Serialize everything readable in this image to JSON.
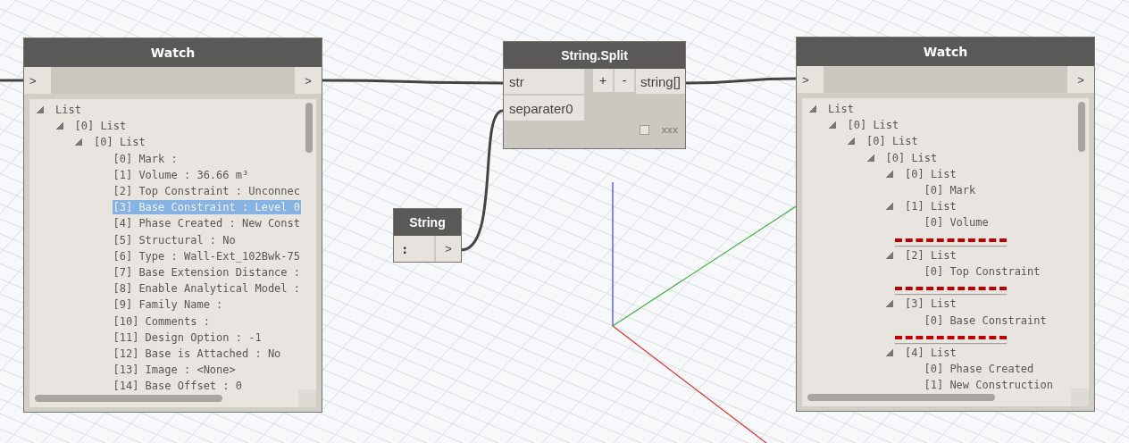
{
  "canvas": {
    "nodes": [
      {
        "kind": "watch",
        "title": "Watch",
        "input_port": ">",
        "output_port": ">",
        "tree": {
          "label": "List",
          "expanded": true,
          "children": [
            {
              "label": "[0] List",
              "expanded": true,
              "children": [
                {
                  "label": "[0] List",
                  "expanded": true,
                  "children": [
                    {
                      "label": "[0] Mark :",
                      "selected": false
                    },
                    {
                      "label": "[1] Volume : 36.66 m³",
                      "selected": false
                    },
                    {
                      "label": "[2] Top Constraint : Unconnec",
                      "selected": false
                    },
                    {
                      "label": "[3] Base Constraint : Level 0",
                      "selected": true
                    },
                    {
                      "label": "[4] Phase Created : New Const",
                      "selected": false
                    },
                    {
                      "label": "[5] Structural : No",
                      "selected": false
                    },
                    {
                      "label": "[6] Type : Wall-Ext_102Bwk-75",
                      "selected": false
                    },
                    {
                      "label": "[7] Base Extension Distance :",
                      "selected": false
                    },
                    {
                      "label": "[8] Enable Analytical Model :",
                      "selected": false
                    },
                    {
                      "label": "[9] Family Name :",
                      "selected": false
                    },
                    {
                      "label": "[10] Comments :",
                      "selected": false
                    },
                    {
                      "label": "[11] Design Option : -1",
                      "selected": false
                    },
                    {
                      "label": "[12] Base is Attached : No",
                      "selected": false
                    },
                    {
                      "label": "[13] Image : <None>",
                      "selected": false
                    },
                    {
                      "label": "[14] Base Offset : 0",
                      "selected": false
                    }
                  ]
                }
              ]
            }
          ]
        }
      },
      {
        "kind": "function",
        "title": "String.Split",
        "inputs": [
          "str",
          "separater0"
        ],
        "buttons": [
          "+",
          "-"
        ],
        "outputs": [
          "string[]"
        ],
        "preview_checked": false,
        "lacing": "xxx"
      },
      {
        "kind": "string",
        "title": "String",
        "value": ":",
        "output_port": ">"
      },
      {
        "kind": "watch",
        "title": "Watch",
        "input_port": ">",
        "output_port": ">",
        "tree": {
          "label": "List",
          "expanded": true,
          "children": [
            {
              "label": "[0] List",
              "expanded": true,
              "children": [
                {
                  "label": "[0] List",
                  "expanded": true,
                  "children": [
                    {
                      "label": "[0] List",
                      "expanded": true,
                      "children": [
                        {
                          "label": "[0] List",
                          "expanded": true,
                          "children": [
                            {
                              "label": "[0] Mark",
                              "selected": false,
                              "redacted": false
                            }
                          ]
                        },
                        {
                          "label": "[1] List",
                          "expanded": true,
                          "children": [
                            {
                              "label": "[0] Volume",
                              "selected": false,
                              "redacted": false
                            },
                            {
                              "selected": false,
                              "redacted": true
                            }
                          ]
                        },
                        {
                          "label": "[2] List",
                          "expanded": true,
                          "children": [
                            {
                              "label": "[0] Top Constraint",
                              "selected": false,
                              "redacted": false
                            },
                            {
                              "selected": false,
                              "redacted": true
                            }
                          ]
                        },
                        {
                          "label": "[3] List",
                          "expanded": true,
                          "children": [
                            {
                              "label": "[0] Base Constraint",
                              "selected": false,
                              "redacted": false
                            },
                            {
                              "selected": false,
                              "redacted": true
                            }
                          ]
                        },
                        {
                          "label": "[4] List",
                          "expanded": true,
                          "children": [
                            {
                              "label": "[0] Phase Created",
                              "selected": false,
                              "redacted": false
                            },
                            {
                              "label": "[1] New Construction",
                              "selected": false,
                              "redacted": false
                            }
                          ]
                        }
                      ]
                    }
                  ]
                }
              ]
            }
          ]
        }
      }
    ]
  }
}
